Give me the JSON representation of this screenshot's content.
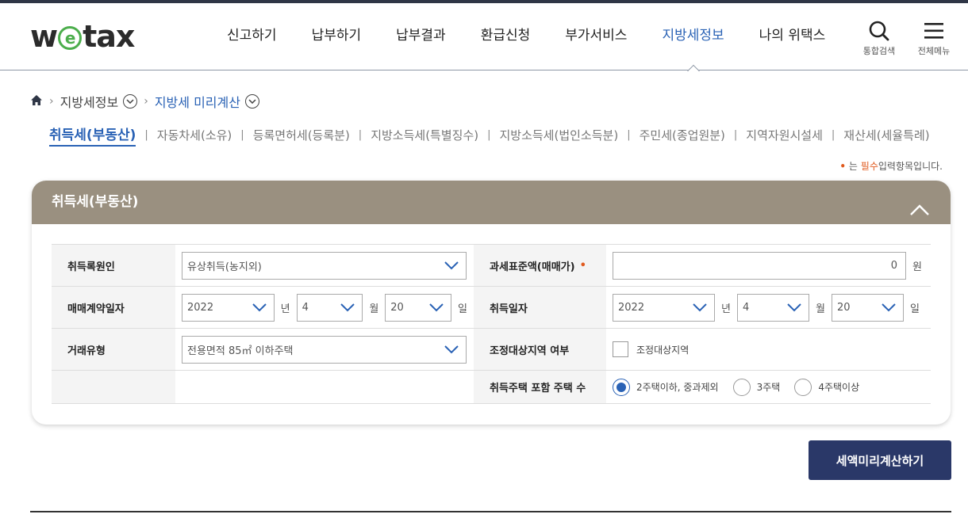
{
  "header": {
    "logo": {
      "w": "w",
      "e": "e",
      "tax": "tax"
    },
    "nav": [
      "신고하기",
      "납부하기",
      "납부결과",
      "환급신청",
      "부가서비스",
      "지방세정보",
      "나의 위택스"
    ],
    "active_nav": "지방세정보",
    "search_label": "통합검색",
    "menu_label": "전체메뉴"
  },
  "breadcrumb": {
    "level1": "지방세정보",
    "level2": "지방세 미리계산"
  },
  "tabs": [
    "취득세(부동산)",
    "자동차세(소유)",
    "등록면허세(등록분)",
    "지방소득세(특별징수)",
    "지방소득세(법인소득분)",
    "주민세(종업원분)",
    "지역자원시설세",
    "재산세(세율특례)"
  ],
  "required_note": {
    "dot": "•",
    "pre": "는",
    "em": "필수",
    "post": "입력항목입니다."
  },
  "panel": {
    "title": "취득세(부동산)",
    "fields": {
      "cause_label": "취득록원인",
      "cause_value": "유상취득(농지외)",
      "base_label": "과세표준액(매매가)",
      "base_required": "•",
      "base_value": "0",
      "base_unit": "원",
      "contract_label": "매매계약일자",
      "contract_year": "2022",
      "contract_month": "4",
      "contract_day": "20",
      "acq_label": "취득일자",
      "acq_year": "2022",
      "acq_month": "4",
      "acq_day": "20",
      "year_unit": "년",
      "month_unit": "월",
      "day_unit": "일",
      "type_label": "거래유형",
      "type_value": "전용면적 85㎡ 이하주택",
      "region_label": "조정대상지역 여부",
      "region_check": "조정대상지역",
      "count_label": "취득주택 포함 주택 수",
      "count_opt1": "2주택이하, 중과제외",
      "count_opt2": "3주택",
      "count_opt3": "4주택이상"
    }
  },
  "calc_button": "세액미리계산하기",
  "colors": {
    "accent": "#2a62b5",
    "panel_head": "#9a9080",
    "button": "#2a3868",
    "required": "#e05a1e"
  }
}
